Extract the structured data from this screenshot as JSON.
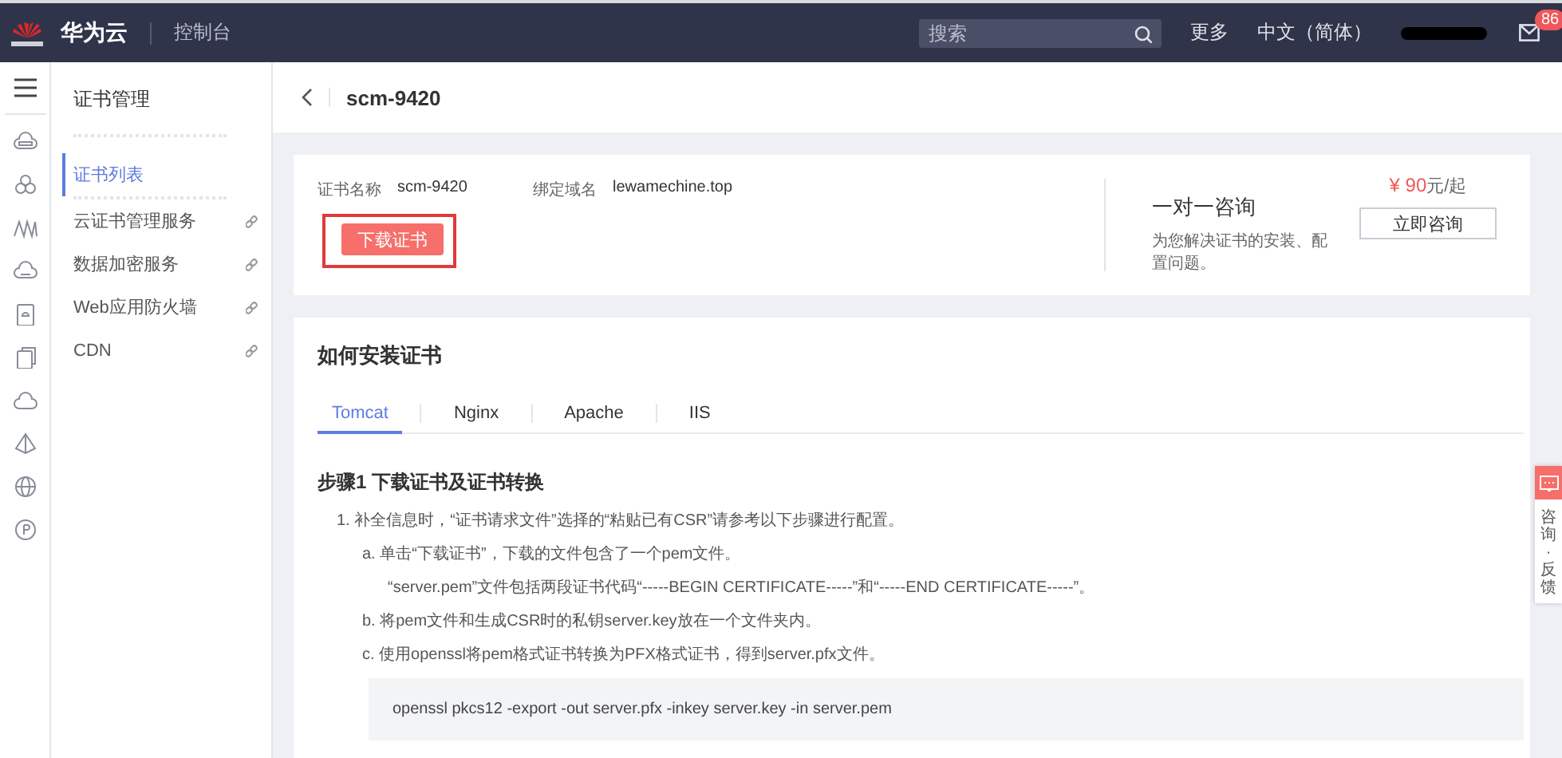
{
  "header": {
    "brand": "华为云",
    "console": "控制台",
    "search_placeholder": "搜索",
    "more": "更多",
    "language": "中文（简体）",
    "notification_count": "86"
  },
  "sidebar": {
    "title": "证书管理",
    "items": [
      {
        "label": "证书列表",
        "selected": true,
        "external": false
      },
      {
        "label": "云证书管理服务",
        "selected": false,
        "external": true
      },
      {
        "label": "数据加密服务",
        "selected": false,
        "external": true
      },
      {
        "label": "Web应用防火墙",
        "selected": false,
        "external": true
      },
      {
        "label": "CDN",
        "selected": false,
        "external": true
      }
    ]
  },
  "page_title": "scm-9420",
  "certificate": {
    "fields": [
      {
        "label": "证书名称",
        "value": "scm-9420"
      },
      {
        "label": "绑定域名",
        "value": "lewamechine.top"
      }
    ],
    "download_button": "下载证书"
  },
  "consult": {
    "title": "一对一咨询",
    "description": "为您解决证书的安装、配置问题。",
    "price": "¥ 90",
    "price_unit": "元/起",
    "button": "立即咨询"
  },
  "install": {
    "title": "如何安装证书",
    "tabs": [
      {
        "label": "Tomcat",
        "selected": true
      },
      {
        "label": "Nginx",
        "selected": false
      },
      {
        "label": "Apache",
        "selected": false
      },
      {
        "label": "IIS",
        "selected": false
      }
    ],
    "step_title": "步骤1 下载证书及证书转换",
    "steps": [
      {
        "kind": "text",
        "text": "1. 补全信息时，“证书请求文件”选择的“粘贴已有CSR”请参考以下步骤进行配置。",
        "children": [
          {
            "kind": "text",
            "text": "a. 单击“下载证书”，下载的文件包含了一个pem文件。",
            "children": [
              {
                "kind": "text",
                "text": "“server.pem”文件包括两段证书代码“-----BEGIN CERTIFICATE-----”和“-----END CERTIFICATE-----”。"
              }
            ]
          },
          {
            "kind": "text",
            "text": "b. 将pem文件和生成CSR时的私钥server.key放在一个文件夹内。"
          },
          {
            "kind": "text",
            "text": "c. 使用openssl将pem格式证书转换为PFX格式证书，得到server.pfx文件。",
            "children": [
              {
                "kind": "code",
                "text": "openssl pkcs12 -export -out server.pfx -inkey server.key -in server.pem"
              }
            ]
          }
        ]
      }
    ]
  },
  "feedback": {
    "label": "咨询·反馈"
  }
}
